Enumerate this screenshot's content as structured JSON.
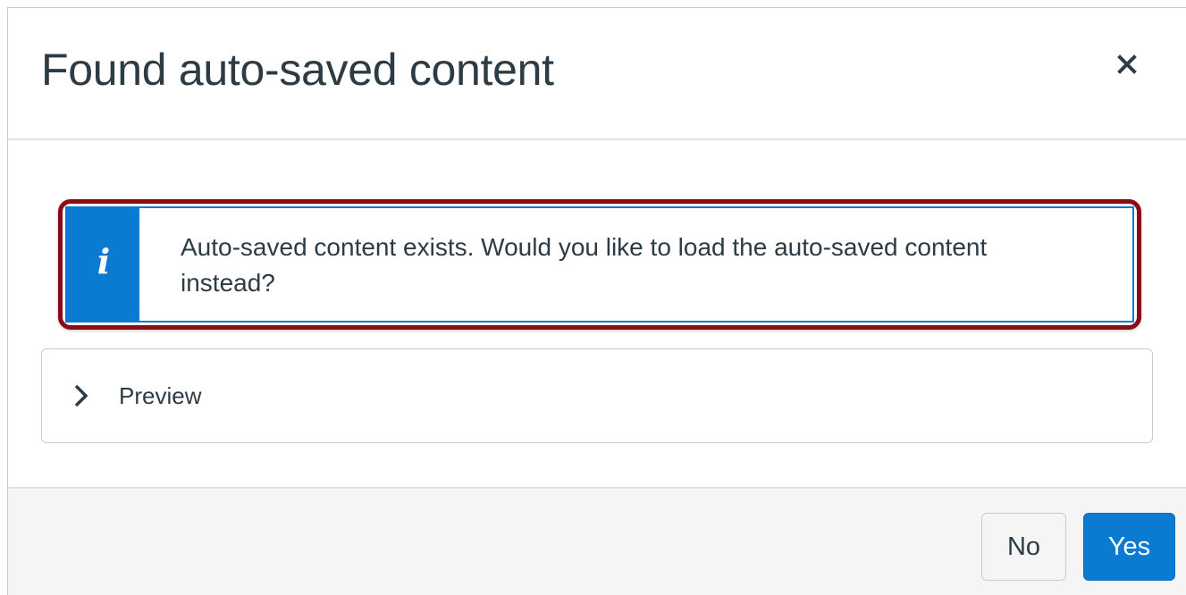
{
  "dialog": {
    "title": "Found auto-saved content",
    "close_icon": "close-icon"
  },
  "alert": {
    "icon": "info-icon",
    "message": "Auto-saved content exists. Would you like to load the auto-saved content instead?",
    "accent_color": "#0b7bd2",
    "highlight_border_color": "#8b0c14"
  },
  "preview": {
    "icon": "chevron-right-icon",
    "label": "Preview"
  },
  "footer": {
    "no_label": "No",
    "yes_label": "Yes",
    "primary_color": "#0b7bd2"
  }
}
